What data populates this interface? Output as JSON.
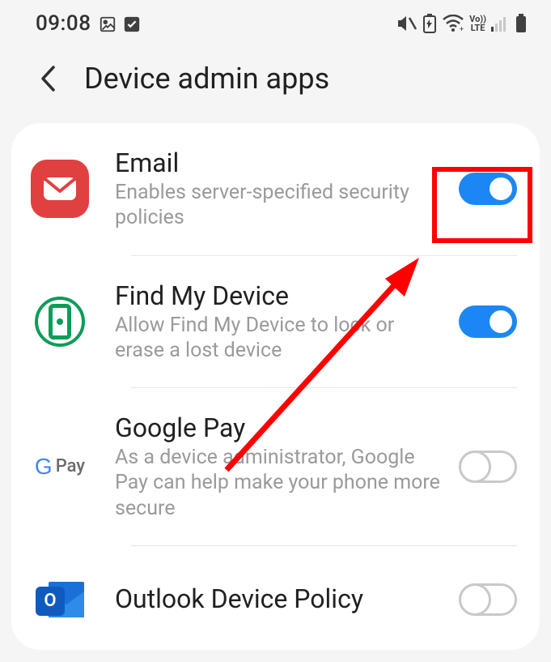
{
  "statusbar": {
    "time": "09:08"
  },
  "header": {
    "title": "Device admin apps"
  },
  "apps": [
    {
      "title": "Email",
      "desc": "Enables server-specified security policies",
      "enabled": true
    },
    {
      "title": "Find My Device",
      "desc": "Allow Find My Device to lock or erase a lost device",
      "enabled": true
    },
    {
      "title": "Google Pay",
      "desc": "As a device administrator, Google Pay can help make your phone more secure",
      "enabled": false
    },
    {
      "title": "Outlook Device Policy",
      "desc": "",
      "enabled": false
    }
  ]
}
